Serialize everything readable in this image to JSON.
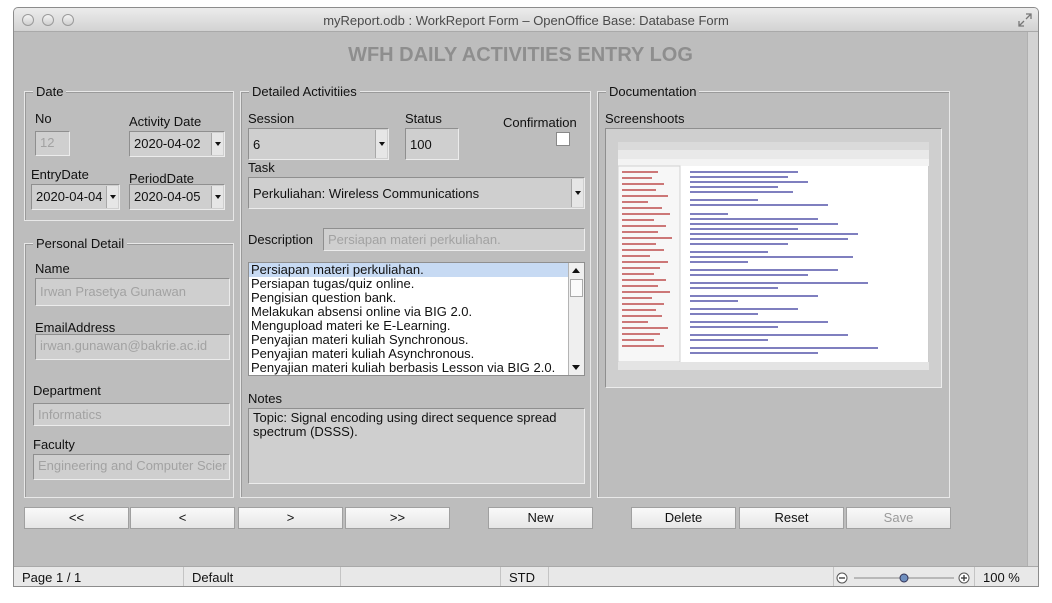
{
  "window": {
    "title": "myReport.odb : WorkReport Form – OpenOffice Base: Database Form"
  },
  "form": {
    "title": "WFH DAILY ACTIVITIES ENTRY LOG"
  },
  "date_group": {
    "legend": "Date",
    "no_label": "No",
    "no_value": "12",
    "activity_date_label": "Activity Date",
    "activity_date_value": "2020-04-02",
    "entry_date_label": "EntryDate",
    "entry_date_value": "2020-04-04",
    "period_date_label": "PeriodDate",
    "period_date_value": "2020-04-05"
  },
  "personal_group": {
    "legend": "Personal Detail",
    "name_label": "Name",
    "name_value": "Irwan Prasetya Gunawan",
    "email_label": "EmailAddress",
    "email_value": "irwan.gunawan@bakrie.ac.id",
    "department_label": "Department",
    "department_value": "Informatics",
    "faculty_label": "Faculty",
    "faculty_value": "Engineering and Computer Scier"
  },
  "activities_group": {
    "legend": "Detailed Activitiies",
    "session_label": "Session",
    "session_value": "6",
    "status_label": "Status",
    "status_value": "100",
    "confirmation_label": "Confirmation",
    "confirmation_checked": false,
    "task_label": "Task",
    "task_value": "Perkuliahan: Wireless Communications",
    "description_label": "Description",
    "description_value": "Persiapan materi perkuliahan.",
    "description_list": [
      "Persiapan materi perkuliahan.",
      "Persiapan tugas/quiz online.",
      "Pengisian question bank.",
      "Melakukan absensi online via BIG 2.0.",
      "Mengupload materi ke E-Learning.",
      "Penyajian materi kuliah Synchronous.",
      "Penyajian materi kuliah Asynchronous.",
      "Penyajian materi kuliah berbasis Lesson via BIG 2.0."
    ],
    "selected_index": 0,
    "notes_label": "Notes",
    "notes_value": "Topic: Signal encoding using direct sequence spread spectrum (DSSS)."
  },
  "documentation_group": {
    "legend": "Documentation",
    "screenshots_label": "Screenshoots"
  },
  "nav_buttons": {
    "first": "<<",
    "prev": "<",
    "next": ">",
    "last": ">>",
    "new": "New",
    "delete": "Delete",
    "reset": "Reset",
    "save": "Save"
  },
  "statusbar": {
    "page": "Page 1 / 1",
    "style": "Default",
    "mode": "STD",
    "zoom": "100 %",
    "zoom_level": 0.5
  },
  "colors": {
    "background": "#bdbdbd",
    "selection": "#c7daf3",
    "title_gray": "#8e8e8e"
  }
}
